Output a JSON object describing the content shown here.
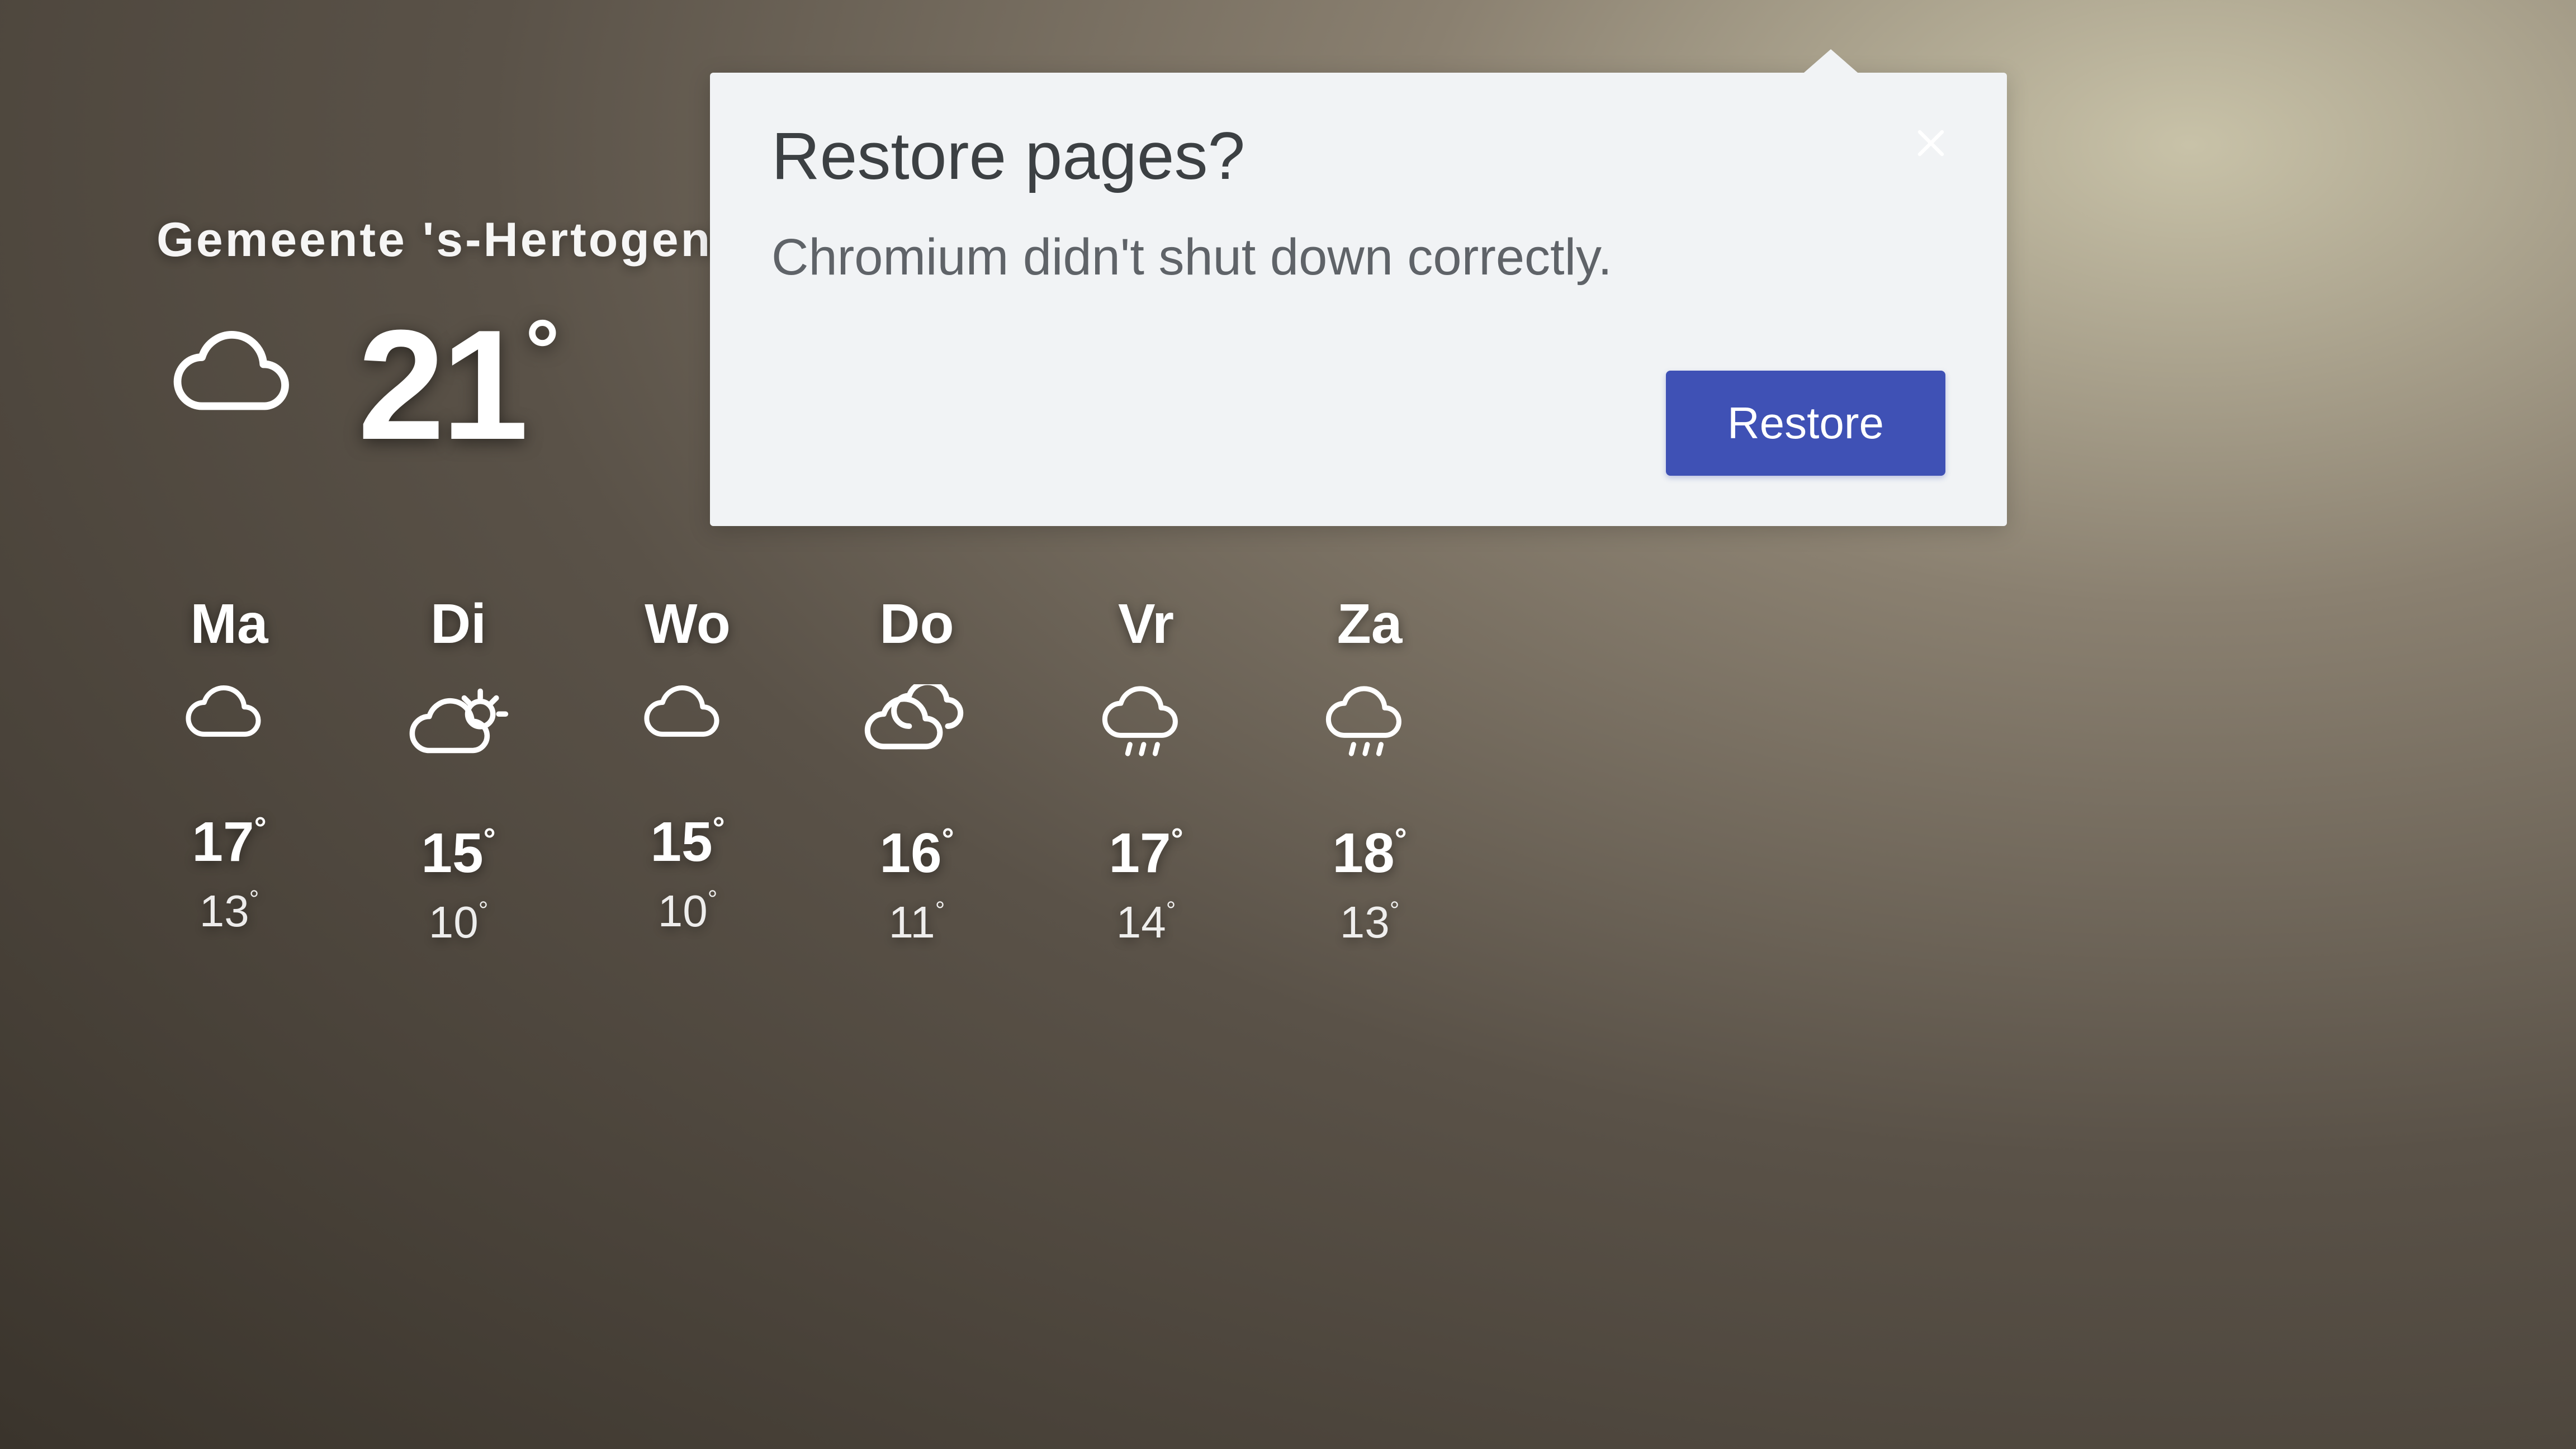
{
  "weather": {
    "location": "Gemeente 's-Hertogenbosch",
    "current_temp": "21",
    "degree_symbol": "°",
    "current_icon": "cloud-icon",
    "forecast": [
      {
        "abbr": "Ma",
        "icon": "cloud-icon",
        "hi": "17",
        "lo": "13"
      },
      {
        "abbr": "Di",
        "icon": "partly-sunny-icon",
        "hi": "15",
        "lo": "10"
      },
      {
        "abbr": "Wo",
        "icon": "cloud-icon",
        "hi": "15",
        "lo": "10"
      },
      {
        "abbr": "Do",
        "icon": "clouds-icon",
        "hi": "16",
        "lo": "11"
      },
      {
        "abbr": "Vr",
        "icon": "rain-icon",
        "hi": "17",
        "lo": "14"
      },
      {
        "abbr": "Za",
        "icon": "rain-icon",
        "hi": "18",
        "lo": "13"
      }
    ]
  },
  "dialog": {
    "title": "Restore pages?",
    "body": "Chromium didn't shut down correctly.",
    "restore_label": "Restore",
    "close_aria": "Close"
  },
  "colors": {
    "dialog_bg": "#f1f3f5",
    "dialog_title": "#3c4043",
    "dialog_body": "#5f6368",
    "primary_button": "#3f51b5"
  }
}
